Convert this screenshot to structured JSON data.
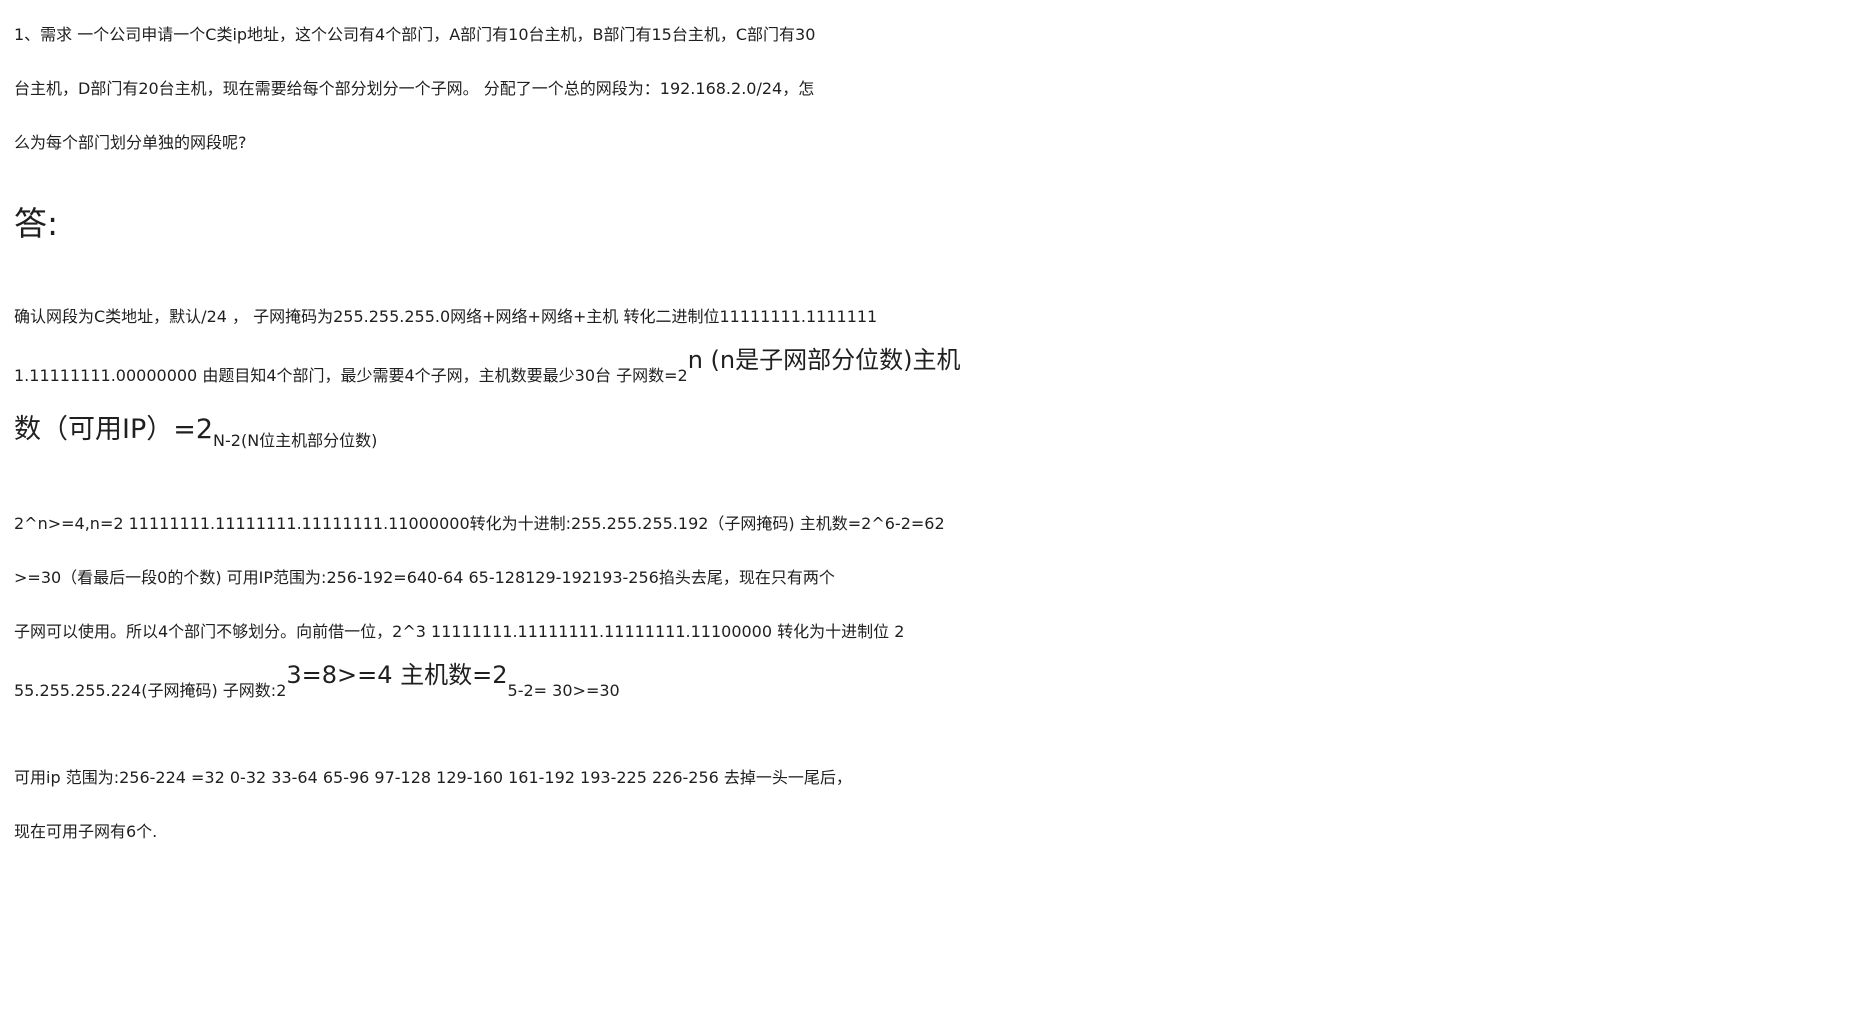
{
  "question": {
    "line1": "1、需求 一个公司申请一个C类ip地址，这个公司有4个部门，A部门有10台主机，B部门有15台主机，C部门有30",
    "line2": "台主机，D部门有20台主机，现在需要给每个部分划分一个子网。 分配了一个总的网段为：192.168.2.0/24，怎",
    "line3": "么为每个部门划分单独的网段呢?"
  },
  "answer_label": "答:",
  "block1": {
    "line1": "确认网段为C类地址，默认/24 ， 子网掩码为255.255.255.0网络+网络+网络+主机 转化二进制位11111111.1111111",
    "line2_main": "1.11111111.00000000 由题目知4个部门，最少需要4个子网，主机数要最少30台 子网数=2",
    "line2_sup": "n (n是子网部分位数)主机",
    "line3_small": "数（可用IP）=2",
    "line3_main": "N-2(N位主机部分位数)"
  },
  "block2": {
    "line1": "2^n>=4,n=2 11111111.11111111.11111111.11000000转化为十进制:255.255.255.192（子网掩码) 主机数=2^6-2=62",
    "line2": ">=30（看最后一段0的个数) 可用IP范围为:256-192=640-64 65-128129-192193-256掐头去尾，现在只有两个",
    "line3": "子网可以使用。所以4个部门不够划分。向前借一位，2^3 11111111.11111111.11111111.11100000 转化为十进制位 2",
    "line4_main": "55.255.255.224(子网掩码) 子网数:2",
    "line4_sup": "3=8>=4 主机数=2",
    "line4_tail": "5-2= 30>=30"
  },
  "block3": {
    "line1": "可用ip 范围为:256-224 =32 0-32 33-64 65-96 97-128 129-160 161-192 193-225 226-256 去掉一头一尾后，",
    "line2": "现在可用子网有6个."
  }
}
